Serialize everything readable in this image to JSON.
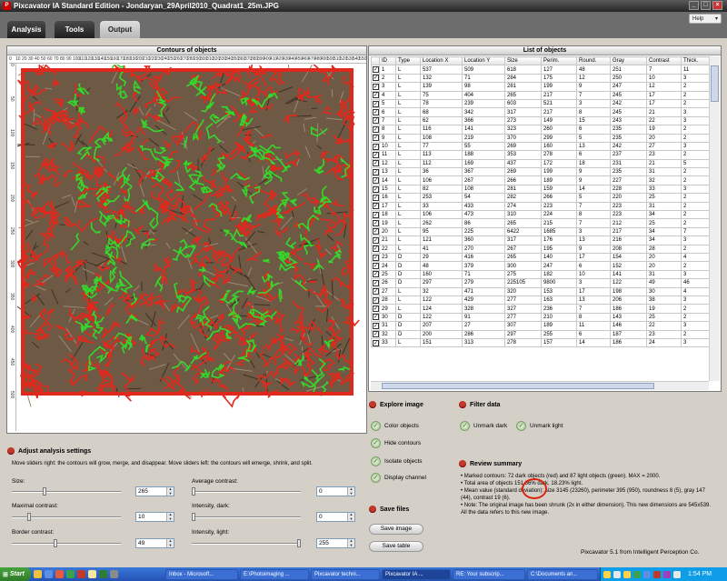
{
  "window": {
    "title": "Pixcavator IA Standard Edition - Jondaryan_29April2010_Quadrat1_25m.JPG",
    "icon_letter": "P",
    "min": "_",
    "max": "□",
    "close": "×"
  },
  "tabs": [
    {
      "label": "Analysis"
    },
    {
      "label": "Tools"
    },
    {
      "label": "Output"
    }
  ],
  "help": {
    "label": "Help",
    "arrow": "▾"
  },
  "contours": {
    "title": "Contours of objects",
    "ruler_top": [
      "0",
      "10",
      "20",
      "30",
      "40",
      "50",
      "60",
      "70",
      "80",
      "90",
      "100",
      "110",
      "120",
      "130",
      "140",
      "150",
      "160",
      "170",
      "180",
      "190",
      "200",
      "210",
      "220",
      "230",
      "240",
      "250",
      "260",
      "270",
      "280",
      "290",
      "300",
      "310",
      "320",
      "330",
      "340",
      "350",
      "360",
      "370",
      "380",
      "390",
      "400",
      "410",
      "420",
      "430",
      "440",
      "450",
      "460",
      "470",
      "480",
      "490",
      "500",
      "510",
      "520",
      "530",
      "540",
      "550"
    ],
    "ruler_left": [
      "0",
      "50",
      "100",
      "150",
      "200",
      "250",
      "300",
      "350",
      "400",
      "450",
      "500"
    ],
    "colors": {
      "dark": "#e0281c",
      "light": "#34d82a",
      "soil": "#6e5a44"
    }
  },
  "adjust": {
    "title": "Adjust analysis settings",
    "hint": "Move sliders right: the contours will grow, merge, and disappear. Move sliders left: the contours will emerge, shrink, and split.",
    "size": {
      "label": "Size:",
      "value": "265",
      "pos": 0.28
    },
    "maximal_contrast": {
      "label": "Maximal contrast:",
      "value": "10",
      "pos": 0.14
    },
    "border_contrast": {
      "label": "Border contrast:",
      "value": "49",
      "pos": 0.38
    },
    "average_contrast": {
      "label": "Average contrast:",
      "value": "0",
      "pos": 0.0
    },
    "intensity_dark": {
      "label": "Intensity, dark:",
      "value": "0",
      "pos": 0.0
    },
    "intensity_light": {
      "label": "Intensity, light:",
      "value": "255",
      "pos": 1.0
    }
  },
  "list": {
    "title": "List of objects",
    "columns": [
      "ID",
      "Type",
      "Location X",
      "Location Y",
      "Size",
      "Perim.",
      "Round.",
      "Gray",
      "Contrast",
      "Thick.",
      "Length"
    ],
    "rows": [
      [
        "1",
        "L",
        "537",
        "509",
        "618",
        "127",
        "48",
        "251",
        "7",
        "11",
        "51"
      ],
      [
        "2",
        "L",
        "132",
        "71",
        "284",
        "175",
        "12",
        "250",
        "10",
        "3",
        "84"
      ],
      [
        "3",
        "L",
        "139",
        "98",
        "281",
        "199",
        "9",
        "247",
        "12",
        "2",
        "97"
      ],
      [
        "4",
        "L",
        "75",
        "404",
        "265",
        "217",
        "7",
        "245",
        "17",
        "2",
        "106"
      ],
      [
        "5",
        "L",
        "78",
        "239",
        "603",
        "521",
        "3",
        "242",
        "17",
        "2",
        "258"
      ],
      [
        "6",
        "L",
        "68",
        "342",
        "317",
        "217",
        "8",
        "245",
        "21",
        "3",
        "105"
      ],
      [
        "7",
        "L",
        "62",
        "366",
        "273",
        "149",
        "15",
        "243",
        "22",
        "3",
        "70"
      ],
      [
        "8",
        "L",
        "116",
        "141",
        "323",
        "260",
        "6",
        "235",
        "19",
        "2",
        "127"
      ],
      [
        "9",
        "L",
        "108",
        "219",
        "370",
        "299",
        "5",
        "235",
        "20",
        "2",
        "147"
      ],
      [
        "10",
        "L",
        "77",
        "55",
        "269",
        "160",
        "13",
        "242",
        "27",
        "3",
        "77"
      ],
      [
        "11",
        "L",
        "113",
        "188",
        "353",
        "278",
        "6",
        "237",
        "23",
        "2",
        "136"
      ],
      [
        "12",
        "L",
        "112",
        "169",
        "437",
        "172",
        "18",
        "231",
        "21",
        "5",
        "81"
      ],
      [
        "13",
        "L",
        "36",
        "367",
        "269",
        "199",
        "9",
        "235",
        "31",
        "2",
        "96"
      ],
      [
        "14",
        "L",
        "106",
        "267",
        "266",
        "189",
        "9",
        "227",
        "32",
        "2",
        "91"
      ],
      [
        "15",
        "L",
        "82",
        "108",
        "281",
        "159",
        "14",
        "228",
        "33",
        "3",
        "75"
      ],
      [
        "16",
        "L",
        "253",
        "54",
        "282",
        "266",
        "5",
        "220",
        "25",
        "2",
        "131"
      ],
      [
        "17",
        "L",
        "33",
        "433",
        "274",
        "223",
        "7",
        "223",
        "31",
        "2",
        "109"
      ],
      [
        "18",
        "L",
        "106",
        "473",
        "310",
        "224",
        "8",
        "223",
        "34",
        "2",
        "109"
      ],
      [
        "19",
        "L",
        "262",
        "86",
        "265",
        "215",
        "7",
        "212",
        "25",
        "2",
        "105"
      ],
      [
        "20",
        "L",
        "95",
        "225",
        "6422",
        "1685",
        "3",
        "217",
        "34",
        "7",
        "835"
      ],
      [
        "21",
        "L",
        "121",
        "360",
        "317",
        "176",
        "13",
        "216",
        "34",
        "3",
        "84"
      ],
      [
        "22",
        "L",
        "41",
        "270",
        "267",
        "195",
        "9",
        "208",
        "28",
        "2",
        "94"
      ],
      [
        "23",
        "D",
        "29",
        "416",
        "265",
        "140",
        "17",
        "154",
        "20",
        "4",
        "65"
      ],
      [
        "24",
        "D",
        "48",
        "379",
        "300",
        "247",
        "6",
        "152",
        "20",
        "2",
        "121"
      ],
      [
        "25",
        "D",
        "160",
        "71",
        "275",
        "182",
        "10",
        "141",
        "31",
        "3",
        "88"
      ],
      [
        "26",
        "D",
        "297",
        "279",
        "225105",
        "9800",
        "3",
        "122",
        "49",
        "46",
        "4853"
      ],
      [
        "27",
        "L",
        "32",
        "471",
        "320",
        "153",
        "17",
        "198",
        "30",
        "4",
        "72"
      ],
      [
        "28",
        "L",
        "122",
        "429",
        "277",
        "163",
        "13",
        "206",
        "38",
        "3",
        "78"
      ],
      [
        "29",
        "L",
        "124",
        "328",
        "327",
        "236",
        "7",
        "186",
        "19",
        "2",
        "115"
      ],
      [
        "30",
        "D",
        "122",
        "91",
        "277",
        "210",
        "8",
        "143",
        "25",
        "2",
        "102"
      ],
      [
        "31",
        "D",
        "207",
        "27",
        "307",
        "189",
        "11",
        "146",
        "22",
        "3",
        "91"
      ],
      [
        "32",
        "D",
        "200",
        "286",
        "297",
        "255",
        "6",
        "187",
        "23",
        "2",
        "125"
      ],
      [
        "33",
        "L",
        "151",
        "313",
        "278",
        "157",
        "14",
        "186",
        "24",
        "3",
        "75"
      ]
    ]
  },
  "explore": {
    "title": "Explore image",
    "items": [
      "Color objects",
      "Hide contours",
      "Isolate objects",
      "Display channel"
    ]
  },
  "filter": {
    "title": "Filter data",
    "items": [
      "Unmark dark",
      "Unmark light"
    ]
  },
  "save": {
    "title": "Save files",
    "image": "Save image",
    "table": "Save table"
  },
  "review": {
    "title": "Review summary",
    "lines": [
      "• Marked contours: 72 dark objects (red) and 87 light objects (green). MAX = 2000.",
      "• Total area of objects 151.86% dark, 18.23% light.",
      "• Mean value (standard deviation): size 3145 (23260), perimeter 395 (950), roundness 8 (5), gray 147 (44), contrast 19 (6).",
      "• Note: The original image has been shrunk (2x in either dimension). This new dimensions are 545x539. All the data refers to this new image."
    ],
    "footer": "Pixcavator 5.1 from Intelligent Perception Co."
  },
  "taskbar": {
    "start": "Start",
    "tasks": [
      "Inbox - Microsoft...",
      "E:\\Photoimaging ...",
      "Pixcavator techni...",
      "Pixcavator IA ...",
      "RE: Your subscrip...",
      "C:\\Documents an..."
    ],
    "clock": "1:54 PM"
  }
}
